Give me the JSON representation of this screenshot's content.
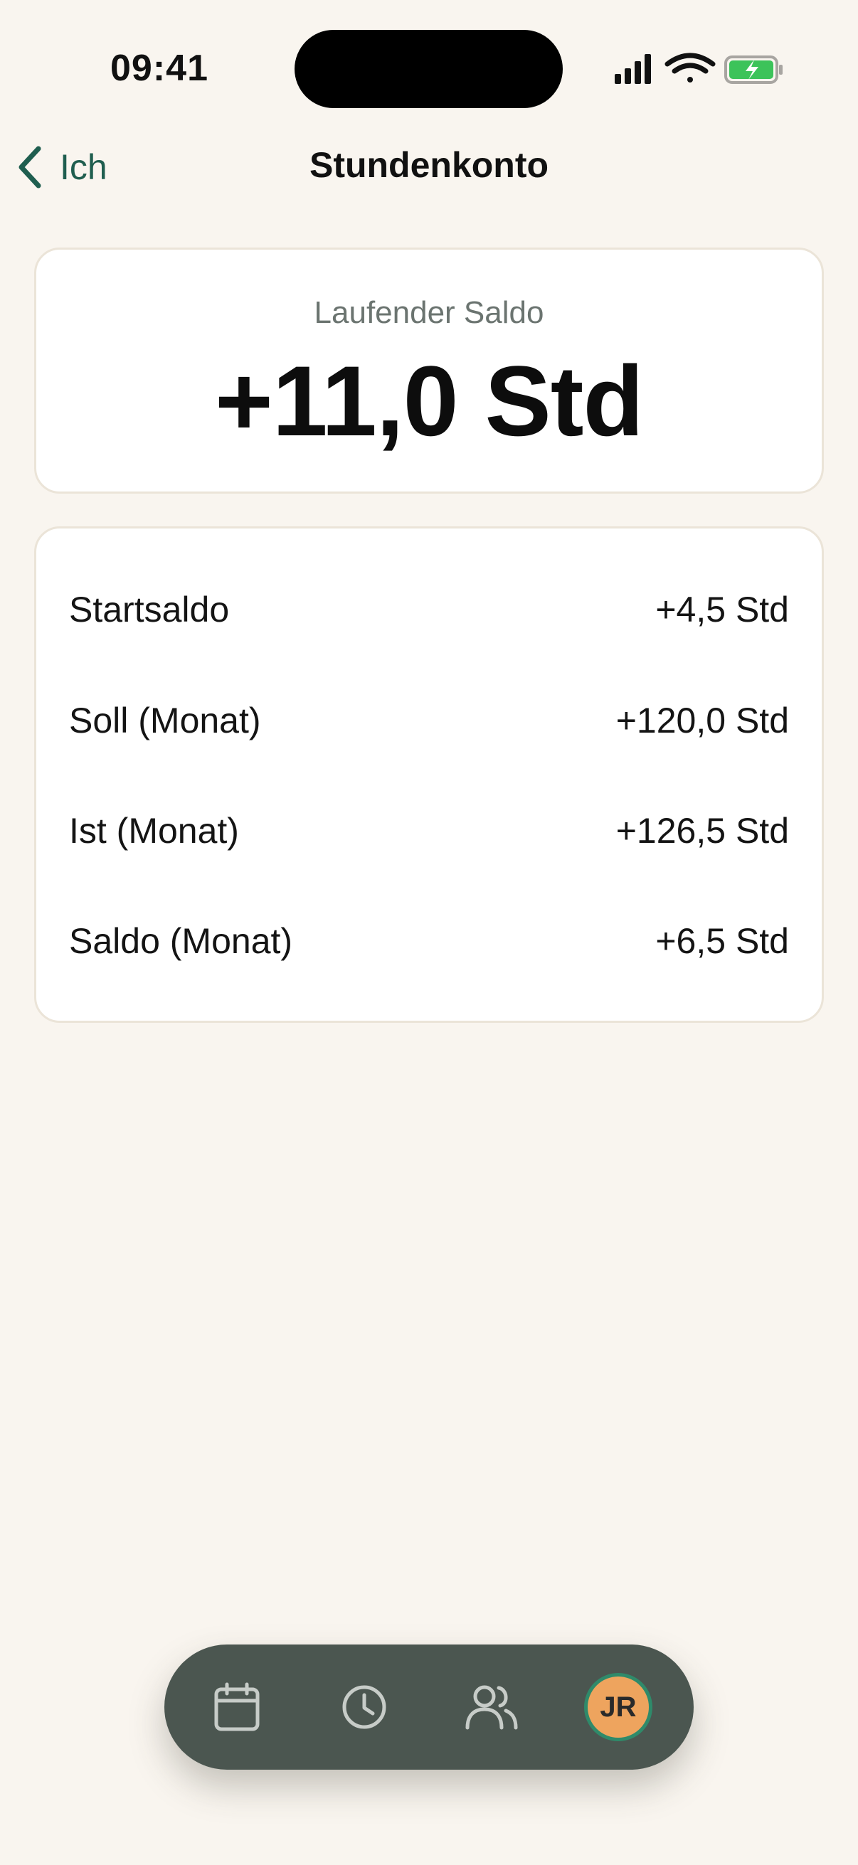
{
  "status_bar": {
    "time": "09:41"
  },
  "nav": {
    "back_label": "Ich",
    "title": "Stundenkonto"
  },
  "balance": {
    "label": "Laufender Saldo",
    "value": "+11,0 Std"
  },
  "details": [
    {
      "label": "Startsaldo",
      "value": "+4,5 Std"
    },
    {
      "label": "Soll (Monat)",
      "value": "+120,0 Std"
    },
    {
      "label": "Ist (Monat)",
      "value": "+126,5 Std"
    },
    {
      "label": "Saldo (Monat)",
      "value": "+6,5 Std"
    }
  ],
  "tabbar": {
    "items": [
      {
        "icon": "calendar-icon"
      },
      {
        "icon": "clock-icon"
      },
      {
        "icon": "people-icon"
      }
    ],
    "avatar_initials": "JR"
  },
  "colors": {
    "accent": "#1f5e4f",
    "background": "#f9f5ef",
    "tabbar": "#4b5650",
    "avatar": "#eea45e",
    "battery": "#3cc35a"
  }
}
